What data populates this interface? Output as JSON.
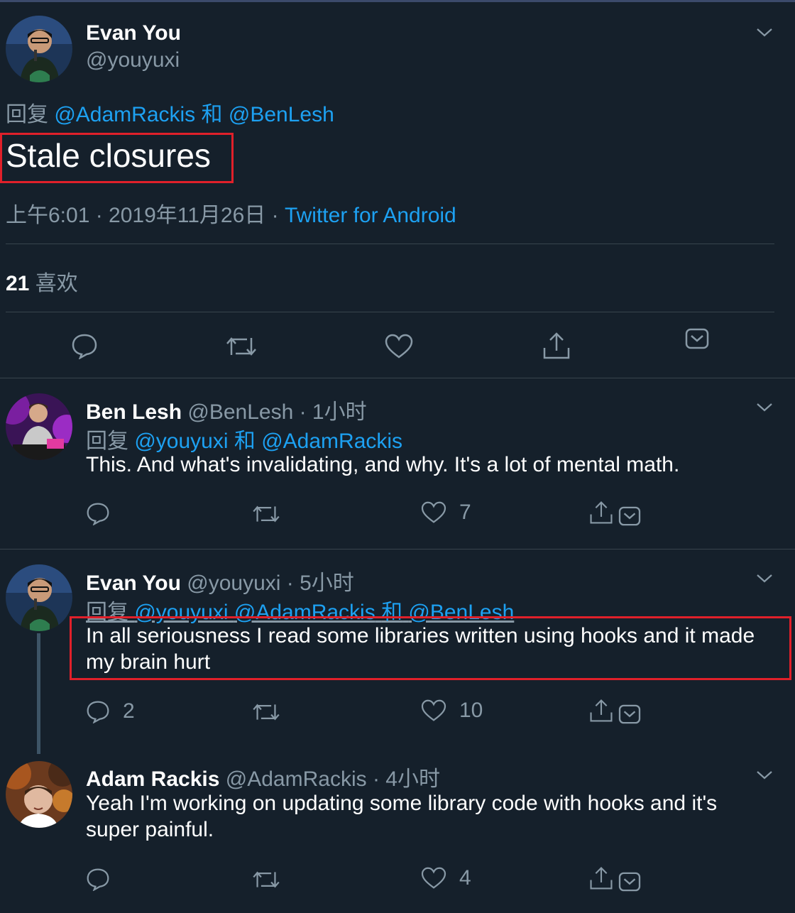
{
  "main_tweet": {
    "author_name": "Evan You",
    "author_handle": "@youyuxi",
    "reply_prefix": "回复",
    "reply_user1": "@AdamRackis",
    "reply_and": "和",
    "reply_user2": "@BenLesh",
    "text": "Stale closures",
    "time": "上午6:01 · 2019年11月26日 · ",
    "source": "Twitter for Android",
    "likes_count": "21",
    "likes_label": "喜欢"
  },
  "replies": [
    {
      "author_name": "Ben Lesh",
      "meta": "@BenLesh · 1小时",
      "reply_prefix": "回复",
      "reply_user1": "@youyuxi",
      "reply_and": "和",
      "reply_user2": "@AdamRackis",
      "text": "This. And what's invalidating, and why. It's a lot of mental math.",
      "reply_count": "",
      "like_count": "7"
    },
    {
      "author_name": "Evan You",
      "meta": "@youyuxi · 5小时",
      "reply_prefix": "回复",
      "reply_user1": "@youyuxi",
      "reply_user2": "@AdamRackis",
      "reply_and": "和",
      "reply_user3": "@BenLesh",
      "text_line1": "In all seriousness I read some libraries written using hooks and it made",
      "text_line2": "my brain hurt",
      "reply_count": "2",
      "like_count": "10"
    },
    {
      "author_name": "Adam Rackis",
      "meta": "@AdamRackis · 4小时",
      "text_line1": "Yeah I'm working on updating some library code with hooks and it's",
      "text_line2": "super painful.",
      "like_count": "4"
    }
  ],
  "icons": [
    "chevron-down-icon",
    "reply-icon",
    "retweet-icon",
    "like-icon",
    "share-icon",
    "bookmark-icon"
  ],
  "colors": {
    "background": "#15202b",
    "link": "#1da1f2",
    "muted": "#8899a6",
    "highlight": "#e0202a"
  }
}
